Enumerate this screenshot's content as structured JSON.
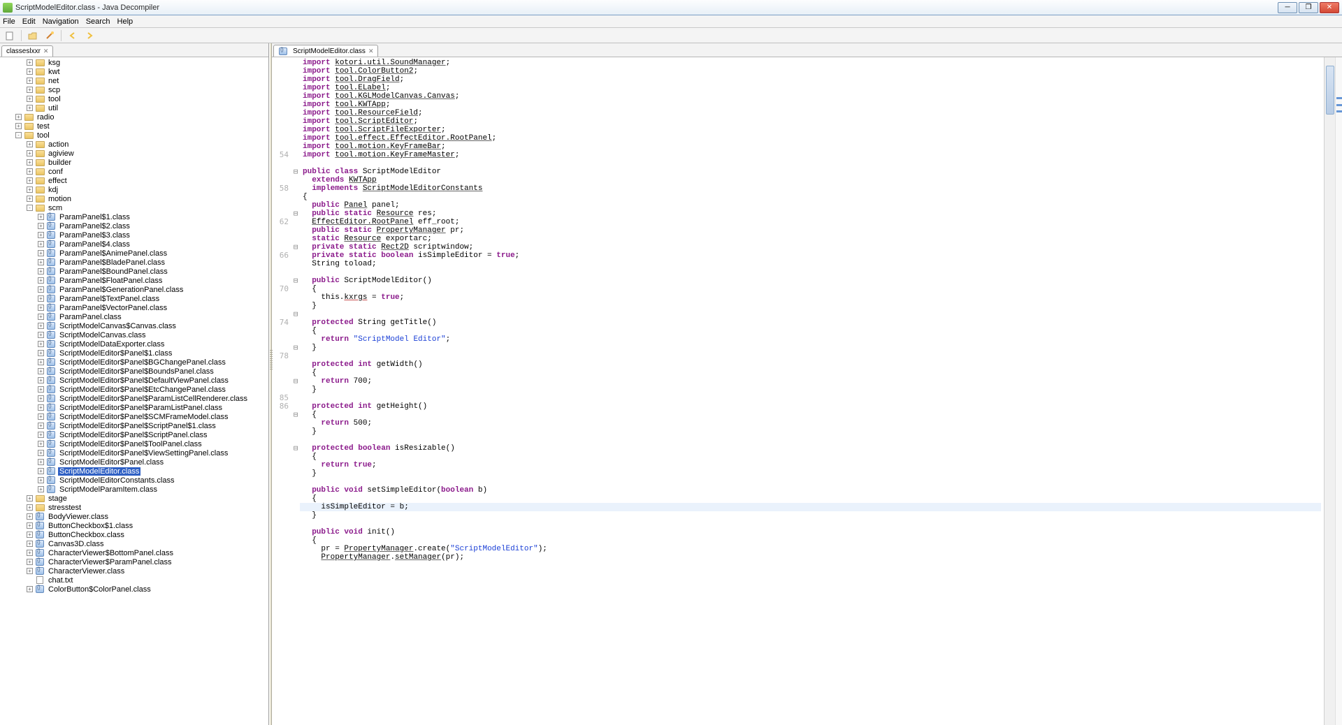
{
  "window": {
    "title": "ScriptModelEditor.class - Java Decompiler"
  },
  "menu": {
    "file": "File",
    "edit": "Edit",
    "nav": "Navigation",
    "search": "Search",
    "help": "Help"
  },
  "left_tab": {
    "label": "classeslxxr",
    "close": "✕"
  },
  "tree": [
    {
      "d": 2,
      "e": "+",
      "t": "folder",
      "l": "ksg"
    },
    {
      "d": 2,
      "e": "+",
      "t": "folder",
      "l": "kwt"
    },
    {
      "d": 2,
      "e": "+",
      "t": "folder",
      "l": "net"
    },
    {
      "d": 2,
      "e": "+",
      "t": "folder",
      "l": "scp"
    },
    {
      "d": 2,
      "e": "+",
      "t": "folder",
      "l": "tool"
    },
    {
      "d": 2,
      "e": "+",
      "t": "folder",
      "l": "util"
    },
    {
      "d": 1,
      "e": "+",
      "t": "folder",
      "l": "radio"
    },
    {
      "d": 1,
      "e": "+",
      "t": "folder",
      "l": "test"
    },
    {
      "d": 1,
      "e": "-",
      "t": "folder",
      "l": "tool"
    },
    {
      "d": 2,
      "e": "+",
      "t": "folder",
      "l": "action"
    },
    {
      "d": 2,
      "e": "+",
      "t": "folder",
      "l": "agiview"
    },
    {
      "d": 2,
      "e": "+",
      "t": "folder",
      "l": "builder"
    },
    {
      "d": 2,
      "e": "+",
      "t": "folder",
      "l": "conf"
    },
    {
      "d": 2,
      "e": "+",
      "t": "folder",
      "l": "effect"
    },
    {
      "d": 2,
      "e": "+",
      "t": "folder",
      "l": "kdj"
    },
    {
      "d": 2,
      "e": "+",
      "t": "folder",
      "l": "motion"
    },
    {
      "d": 2,
      "e": "-",
      "t": "folder",
      "l": "scm"
    },
    {
      "d": 3,
      "e": "+",
      "t": "class",
      "l": "ParamPanel$1.class"
    },
    {
      "d": 3,
      "e": "+",
      "t": "class",
      "l": "ParamPanel$2.class"
    },
    {
      "d": 3,
      "e": "+",
      "t": "class",
      "l": "ParamPanel$3.class"
    },
    {
      "d": 3,
      "e": "+",
      "t": "class",
      "l": "ParamPanel$4.class"
    },
    {
      "d": 3,
      "e": "+",
      "t": "class",
      "l": "ParamPanel$AnimePanel.class"
    },
    {
      "d": 3,
      "e": "+",
      "t": "class",
      "l": "ParamPanel$BladePanel.class"
    },
    {
      "d": 3,
      "e": "+",
      "t": "class",
      "l": "ParamPanel$BoundPanel.class"
    },
    {
      "d": 3,
      "e": "+",
      "t": "class",
      "l": "ParamPanel$FloatPanel.class"
    },
    {
      "d": 3,
      "e": "+",
      "t": "class",
      "l": "ParamPanel$GenerationPanel.class"
    },
    {
      "d": 3,
      "e": "+",
      "t": "class",
      "l": "ParamPanel$TextPanel.class"
    },
    {
      "d": 3,
      "e": "+",
      "t": "class",
      "l": "ParamPanel$VectorPanel.class"
    },
    {
      "d": 3,
      "e": "+",
      "t": "class",
      "l": "ParamPanel.class"
    },
    {
      "d": 3,
      "e": "+",
      "t": "class",
      "l": "ScriptModelCanvas$Canvas.class"
    },
    {
      "d": 3,
      "e": "+",
      "t": "class",
      "l": "ScriptModelCanvas.class"
    },
    {
      "d": 3,
      "e": "+",
      "t": "class",
      "l": "ScriptModelDataExporter.class"
    },
    {
      "d": 3,
      "e": "+",
      "t": "class",
      "l": "ScriptModelEditor$Panel$1.class"
    },
    {
      "d": 3,
      "e": "+",
      "t": "class",
      "l": "ScriptModelEditor$Panel$BGChangePanel.class"
    },
    {
      "d": 3,
      "e": "+",
      "t": "class",
      "l": "ScriptModelEditor$Panel$BoundsPanel.class"
    },
    {
      "d": 3,
      "e": "+",
      "t": "class",
      "l": "ScriptModelEditor$Panel$DefaultViewPanel.class"
    },
    {
      "d": 3,
      "e": "+",
      "t": "class",
      "l": "ScriptModelEditor$Panel$EtcChangePanel.class"
    },
    {
      "d": 3,
      "e": "+",
      "t": "class",
      "l": "ScriptModelEditor$Panel$ParamListCellRenderer.class"
    },
    {
      "d": 3,
      "e": "+",
      "t": "class",
      "l": "ScriptModelEditor$Panel$ParamListPanel.class"
    },
    {
      "d": 3,
      "e": "+",
      "t": "class",
      "l": "ScriptModelEditor$Panel$SCMFrameModel.class"
    },
    {
      "d": 3,
      "e": "+",
      "t": "class",
      "l": "ScriptModelEditor$Panel$ScriptPanel$1.class"
    },
    {
      "d": 3,
      "e": "+",
      "t": "class",
      "l": "ScriptModelEditor$Panel$ScriptPanel.class"
    },
    {
      "d": 3,
      "e": "+",
      "t": "class",
      "l": "ScriptModelEditor$Panel$ToolPanel.class"
    },
    {
      "d": 3,
      "e": "+",
      "t": "class",
      "l": "ScriptModelEditor$Panel$ViewSettingPanel.class"
    },
    {
      "d": 3,
      "e": "+",
      "t": "class",
      "l": "ScriptModelEditor$Panel.class"
    },
    {
      "d": 3,
      "e": "+",
      "t": "class",
      "l": "ScriptModelEditor.class",
      "sel": true
    },
    {
      "d": 3,
      "e": "+",
      "t": "class",
      "l": "ScriptModelEditorConstants.class"
    },
    {
      "d": 3,
      "e": "+",
      "t": "class",
      "l": "ScriptModelParamItem.class"
    },
    {
      "d": 2,
      "e": "+",
      "t": "folder",
      "l": "stage"
    },
    {
      "d": 2,
      "e": "+",
      "t": "folder",
      "l": "stresstest"
    },
    {
      "d": 2,
      "e": "+",
      "t": "class",
      "l": "BodyViewer.class"
    },
    {
      "d": 2,
      "e": "+",
      "t": "class",
      "l": "ButtonCheckbox$1.class"
    },
    {
      "d": 2,
      "e": "+",
      "t": "class",
      "l": "ButtonCheckbox.class"
    },
    {
      "d": 2,
      "e": "+",
      "t": "class",
      "l": "Canvas3D.class"
    },
    {
      "d": 2,
      "e": "+",
      "t": "class",
      "l": "CharacterViewer$BottomPanel.class"
    },
    {
      "d": 2,
      "e": "+",
      "t": "class",
      "l": "CharacterViewer$ParamPanel.class"
    },
    {
      "d": 2,
      "e": "+",
      "t": "class",
      "l": "CharacterViewer.class"
    },
    {
      "d": 2,
      "e": " ",
      "t": "file",
      "l": "chat.txt"
    },
    {
      "d": 2,
      "e": "+",
      "t": "class",
      "l": "ColorButton$ColorPanel.class"
    }
  ],
  "editor_tab": {
    "label": "ScriptModelEditor.class",
    "close": "✕"
  },
  "line_numbers": {
    "54": "54",
    "58": "58",
    "62": "62",
    "66": "66",
    "70": "70",
    "74": "74",
    "78": "78",
    "85": "85",
    "86": "86"
  },
  "code": {
    "l01a": "import",
    "l01b": "kotori.util.SoundManager",
    "l01c": ";",
    "l02a": "import",
    "l02b": "tool.ColorButton2",
    "l02c": ";",
    "l03a": "import",
    "l03b": "tool.DragField",
    "l03c": ";",
    "l04a": "import",
    "l04b": "tool.ELabel",
    "l04c": ";",
    "l05a": "import",
    "l05b": "tool.KGLModelCanvas.Canvas",
    "l05c": ";",
    "l06a": "import",
    "l06b": "tool.KWTApp",
    "l06c": ";",
    "l07a": "import",
    "l07b": "tool.ResourceField",
    "l07c": ";",
    "l08a": "import",
    "l08b": "tool.ScriptEditor",
    "l08c": ";",
    "l09a": "import",
    "l09b": "tool.ScriptFileExporter",
    "l09c": ";",
    "l10a": "import",
    "l10b": "tool.effect.EffectEditor.RootPanel",
    "l10c": ";",
    "l11a": "import",
    "l11b": "tool.motion.KeyFrameBar",
    "l11c": ";",
    "l12a": "import",
    "l12b": "tool.motion.KeyFrameMaster",
    "l12c": ";",
    "l14a": "public class",
    "l14b": " ScriptModelEditor",
    "l15a": "  extends ",
    "l15b": "KWTApp",
    "l16a": "  implements ",
    "l16b": "ScriptModelEditorConstants",
    "l17": "{",
    "l18a": "  public ",
    "l18b": "Panel",
    "l18c": " panel;",
    "l19a": "  public static ",
    "l19b": "Resource",
    "l19c": " res;",
    "l20a": "  ",
    "l20b": "EffectEditor.RootPanel",
    "l20c": " eff_root;",
    "l21a": "  public static ",
    "l21b": "PropertyManager",
    "l21c": " pr;",
    "l22a": "  static ",
    "l22b": "Resource",
    "l22c": " exportarc;",
    "l23a": "  private static ",
    "l23b": "Rect2D",
    "l23c": " scriptwindow;",
    "l24a": "  private static boolean",
    "l24b": " isSimpleEditor = ",
    "l24c": "true",
    "l24d": ";",
    "l25": "  String toload;",
    "l27a": "  public",
    "l27b": " ScriptModelEditor()",
    "l28": "  {",
    "l29a": "    this.",
    "l29b": "kxrgs",
    "l29c": " = ",
    "l29d": "true",
    "l29e": ";",
    "l30": "  }",
    "l32a": "  protected",
    "l32b": " String getTitle()",
    "l33": "  {",
    "l34a": "    return ",
    "l34b": "\"ScriptModel Editor\"",
    "l34c": ";",
    "l35": "  }",
    "l37a": "  protected int",
    "l37b": " getWidth()",
    "l38": "  {",
    "l39a": "    return ",
    "l39b": "700",
    "l39c": ";",
    "l40": "  }",
    "l42a": "  protected int",
    "l42b": " getHeight()",
    "l43": "  {",
    "l44a": "    return ",
    "l44b": "500",
    "l44c": ";",
    "l45": "  }",
    "l47a": "  protected boolean",
    "l47b": " isResizable()",
    "l48": "  {",
    "l49a": "    return ",
    "l49b": "true",
    "l49c": ";",
    "l50": "  }",
    "l52a": "  public void",
    "l52b": " setSimpleEditor(",
    "l52c": "boolean",
    "l52d": " b)",
    "l53": "  {",
    "l54": "    isSimpleEditor = b;",
    "l55": "  }",
    "l57a": "  public void",
    "l57b": " init()",
    "l58": "  {",
    "l59a": "    pr = ",
    "l59b": "PropertyManager",
    "l59c": ".create(",
    "l59d": "\"ScriptModelEditor\"",
    "l59e": ");",
    "l60a": "    ",
    "l60b": "PropertyManager",
    "l60c": ".",
    "l60d": "setManager",
    "l60e": "(pr);"
  }
}
